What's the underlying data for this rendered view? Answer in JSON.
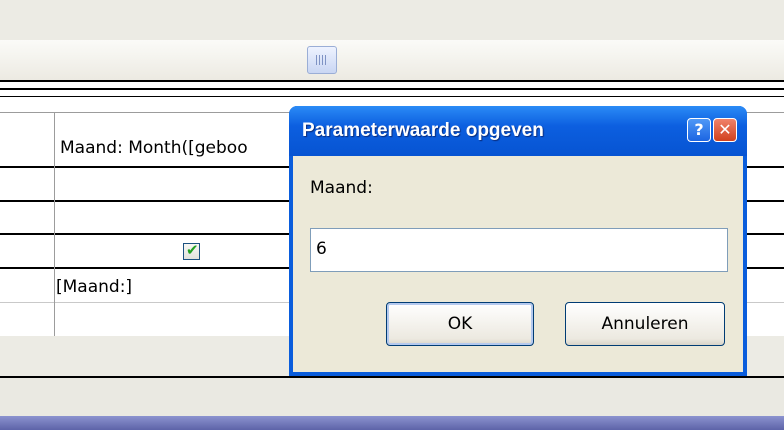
{
  "query_grid": {
    "field_cell": "Maand: Month([geboo",
    "criteria_cell": "[Maand:]",
    "show_checkbox": true
  },
  "dialog": {
    "title": "Parameterwaarde opgeven",
    "help_glyph": "?",
    "close_glyph": "✕",
    "prompt_label": "Maand:",
    "input_value": "6",
    "ok_label": "OK",
    "cancel_label": "Annuleren"
  },
  "colors": {
    "titlebar": "#0c5fe0",
    "dialog_client": "#ece9d8",
    "checkmark": "#21a121"
  }
}
